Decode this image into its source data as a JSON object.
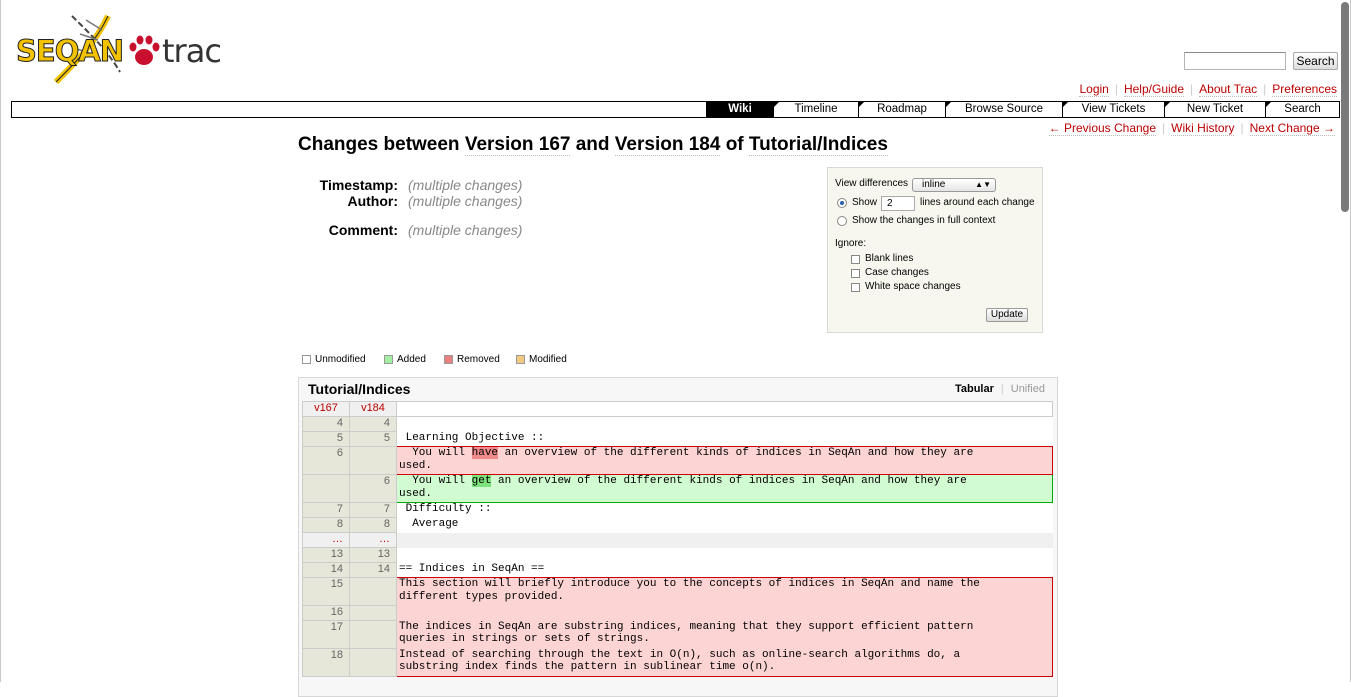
{
  "logo": {
    "brand": "SEQAN",
    "product": "trac"
  },
  "search": {
    "placeholder": "",
    "button": "Search"
  },
  "metanav": [
    "Login",
    "Help/Guide",
    "About Trac",
    "Preferences"
  ],
  "mainnav": [
    "Wiki",
    "Timeline",
    "Roadmap",
    "Browse Source",
    "View Tickets",
    "New Ticket",
    "Search"
  ],
  "ctxnav": {
    "prev": "← Previous Change",
    "history": "Wiki History",
    "next": "Next Change →"
  },
  "title": {
    "prefix": "Changes between ",
    "v1": "Version 167",
    "and": " and ",
    "v2": "Version 184",
    "of": " of ",
    "page": "Tutorial/Indices"
  },
  "overview": {
    "timestamp_label": "Timestamp:",
    "timestamp_value": "(multiple changes)",
    "author_label": "Author:",
    "author_value": "(multiple changes)",
    "comment_label": "Comment:",
    "comment_value": "(multiple changes)"
  },
  "prefs": {
    "view_label": "View differences",
    "view_value": "inline",
    "show_label": "Show",
    "context_value": "2",
    "context_suffix": "lines around each change",
    "full_context": "Show the changes in full context",
    "ignore_label": "Ignore:",
    "ignore_blank": "Blank lines",
    "ignore_case": "Case changes",
    "ignore_ws": "White space changes",
    "update": "Update"
  },
  "legend": {
    "unmodified": "Unmodified",
    "added": "Added",
    "removed": "Removed",
    "modified": "Modified",
    "colors": {
      "unmodified": "#ffffff",
      "added": "#a3f0a3",
      "removed": "#e98080",
      "modified": "#f0c880"
    }
  },
  "diff": {
    "file": "Tutorial/Indices",
    "style_tabular": "Tabular",
    "style_unified": "Unified",
    "col_old": "v167",
    "col_new": "v184",
    "rows": [
      {
        "type": "ctx",
        "o": "4",
        "n": "4",
        "text": ""
      },
      {
        "type": "ctx",
        "o": "5",
        "n": "5",
        "text": " Learning Objective ::"
      },
      {
        "type": "rm",
        "o": "6",
        "n": "",
        "pre": "  You will ",
        "hl": "have",
        "post": " an overview of the different kinds of indices in SeqAn and how they are\nused."
      },
      {
        "type": "add",
        "o": "",
        "n": "6",
        "pre": "  You will ",
        "hl": "get",
        "post": " an overview of the different kinds of indices in SeqAn and how they are\nused."
      },
      {
        "type": "ctx",
        "o": "7",
        "n": "7",
        "text": " Difficulty ::"
      },
      {
        "type": "ctx",
        "o": "8",
        "n": "8",
        "text": "  Average"
      },
      {
        "type": "gap",
        "o": "…",
        "n": "…",
        "text": ""
      },
      {
        "type": "ctx",
        "o": "13",
        "n": "13",
        "text": ""
      },
      {
        "type": "ctx",
        "o": "14",
        "n": "14",
        "text": "== Indices in SeqAn =="
      },
      {
        "type": "rm",
        "o": "15",
        "n": "",
        "text": "This section will briefly introduce you to the concepts of indices in SeqAn and name the\ndifferent types provided."
      },
      {
        "type": "rm",
        "o": "16",
        "n": "",
        "text": ""
      },
      {
        "type": "rm",
        "o": "17",
        "n": "",
        "text": "The indices in SeqAn are substring indices, meaning that they support efficient pattern\nqueries in strings or sets of strings."
      },
      {
        "type": "rm",
        "o": "18",
        "n": "",
        "text": "Instead of searching through the text in O(n), such as online-search algorithms do, a\nsubstring index finds the pattern in sublinear time o(n)."
      }
    ]
  }
}
